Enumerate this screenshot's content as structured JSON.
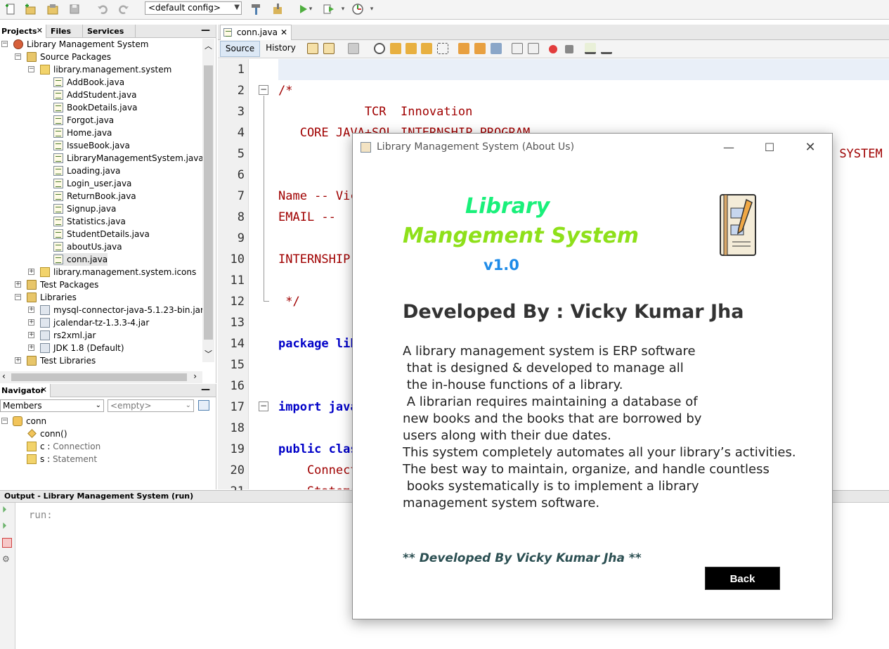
{
  "toolbar": {
    "config": "<default config>"
  },
  "projects": {
    "tabs": [
      "Projects",
      "Files",
      "Services"
    ],
    "tree": [
      {
        "label": "Library Management System",
        "icon": "project-icon",
        "level": 0,
        "expander": "−"
      },
      {
        "label": "Source Packages",
        "icon": "folder-icon",
        "level": 1,
        "expander": "−"
      },
      {
        "label": "library.management.system",
        "icon": "package-icon",
        "level": 2,
        "expander": "−"
      },
      {
        "label": "AddBook.java",
        "icon": "java-file-icon",
        "level": 3
      },
      {
        "label": "AddStudent.java",
        "icon": "java-file-icon",
        "level": 3
      },
      {
        "label": "BookDetails.java",
        "icon": "java-file-icon",
        "level": 3
      },
      {
        "label": "Forgot.java",
        "icon": "java-file-icon",
        "level": 3
      },
      {
        "label": "Home.java",
        "icon": "java-file-icon",
        "level": 3
      },
      {
        "label": "IssueBook.java",
        "icon": "java-file-icon",
        "level": 3
      },
      {
        "label": "LibraryManagementSystem.java",
        "icon": "java-file-icon",
        "level": 3
      },
      {
        "label": "Loading.java",
        "icon": "java-file-icon",
        "level": 3
      },
      {
        "label": "Login_user.java",
        "icon": "java-file-icon",
        "level": 3
      },
      {
        "label": "ReturnBook.java",
        "icon": "java-file-icon",
        "level": 3
      },
      {
        "label": "Signup.java",
        "icon": "java-file-icon",
        "level": 3
      },
      {
        "label": "Statistics.java",
        "icon": "java-file-icon",
        "level": 3
      },
      {
        "label": "StudentDetails.java",
        "icon": "java-file-icon",
        "level": 3
      },
      {
        "label": "aboutUs.java",
        "icon": "java-file-icon",
        "level": 3
      },
      {
        "label": "conn.java",
        "icon": "java-file-icon",
        "level": 3,
        "selected": true
      },
      {
        "label": "library.management.system.icons",
        "icon": "package-icon",
        "level": 2,
        "expander": "+"
      },
      {
        "label": "Test Packages",
        "icon": "folder-icon",
        "level": 1,
        "expander": "+"
      },
      {
        "label": "Libraries",
        "icon": "folder-icon",
        "level": 1,
        "expander": "−"
      },
      {
        "label": "mysql-connector-java-5.1.23-bin.jar",
        "icon": "jar-icon",
        "level": 2,
        "expander": "+"
      },
      {
        "label": "jcalendar-tz-1.3.3-4.jar",
        "icon": "jar-icon",
        "level": 2,
        "expander": "+"
      },
      {
        "label": "rs2xml.jar",
        "icon": "jar-icon",
        "level": 2,
        "expander": "+"
      },
      {
        "label": "JDK 1.8 (Default)",
        "icon": "jdk-icon",
        "level": 2,
        "expander": "+"
      },
      {
        "label": "Test Libraries",
        "icon": "folder-icon",
        "level": 1,
        "expander": "+"
      }
    ]
  },
  "navigator": {
    "title": "Navigator",
    "members_label": "Members",
    "filter": "<empty>",
    "tree": [
      {
        "label": "conn",
        "level": 0
      },
      {
        "label": "conn()",
        "level": 1
      },
      {
        "label": "c",
        "type": "Connection",
        "level": 1
      },
      {
        "label": "s",
        "type": "Statement",
        "level": 1
      }
    ]
  },
  "editor": {
    "tab": "conn.java",
    "source_tab": "Source",
    "history_tab": "History",
    "line_numbers": [
      "1",
      "2",
      "3",
      "4",
      "5",
      "6",
      "7",
      "8",
      "9",
      "10",
      "11",
      "12",
      "13",
      "14",
      "15",
      "16",
      "17",
      "18",
      "19",
      "20",
      "21"
    ],
    "lines": [
      {
        "text": "",
        "cls": ""
      },
      {
        "text": "/*",
        "cls": "cmt"
      },
      {
        "text": "            TCR  Innovation",
        "cls": "cmt"
      },
      {
        "text": "   CORE JAVA+SQL INTERNSHIP PROGRAM",
        "cls": "cmt"
      },
      {
        "text": "                                                        (( LIBRARY MANAGEMENT SYSTEM ))",
        "cls": "cmt"
      },
      {
        "text": "",
        "cls": ""
      },
      {
        "text": "Name -- Vicky Kumar Jha",
        "cls": "cmt"
      },
      {
        "text": "EMAIL -- ",
        "cls": "cmt"
      },
      {
        "text": "",
        "cls": ""
      },
      {
        "text": "INTERNSHIP",
        "cls": "cmt"
      },
      {
        "text": "",
        "cls": ""
      },
      {
        "text": " */",
        "cls": "cmt"
      },
      {
        "text": "",
        "cls": ""
      },
      {
        "text": "package library.management.system;",
        "cls": "kw"
      },
      {
        "text": "",
        "cls": ""
      },
      {
        "text": "",
        "cls": ""
      },
      {
        "text": "import java.sql.*;",
        "cls": "kw"
      },
      {
        "text": "",
        "cls": ""
      },
      {
        "text": "public class conn {",
        "cls": "kw"
      },
      {
        "text": "    Connection c;",
        "cls": "cmt"
      },
      {
        "text": "    Statement s;",
        "cls": "cmt"
      }
    ]
  },
  "output": {
    "title": "Output - Library Management System (run)",
    "text": "run:"
  },
  "dialog": {
    "title": "Library Management System (About Us)",
    "heading1": "Library",
    "heading2": "Mangement System",
    "version": "v1.0",
    "developed_by": "Developed By : Vicky Kumar Jha",
    "description": [
      "A library management system is ERP software",
      " that is designed & developed to manage all",
      " the in-house functions of a library.",
      " A librarian requires maintaining a database of",
      "new books and the books that are borrowed by",
      "users along with their due dates.",
      "This system completely automates all your library’s activities.",
      "The best way to maintain, organize, and handle countless",
      " books systematically is to implement a library",
      "management system software."
    ],
    "footer": "** Developed By Vicky Kumar Jha **",
    "back_label": "Back",
    "colors": {
      "heading1": "#19f07a",
      "heading2": "#8ee01a",
      "version": "#1e8be8",
      "footer": "#2b4f52"
    }
  }
}
